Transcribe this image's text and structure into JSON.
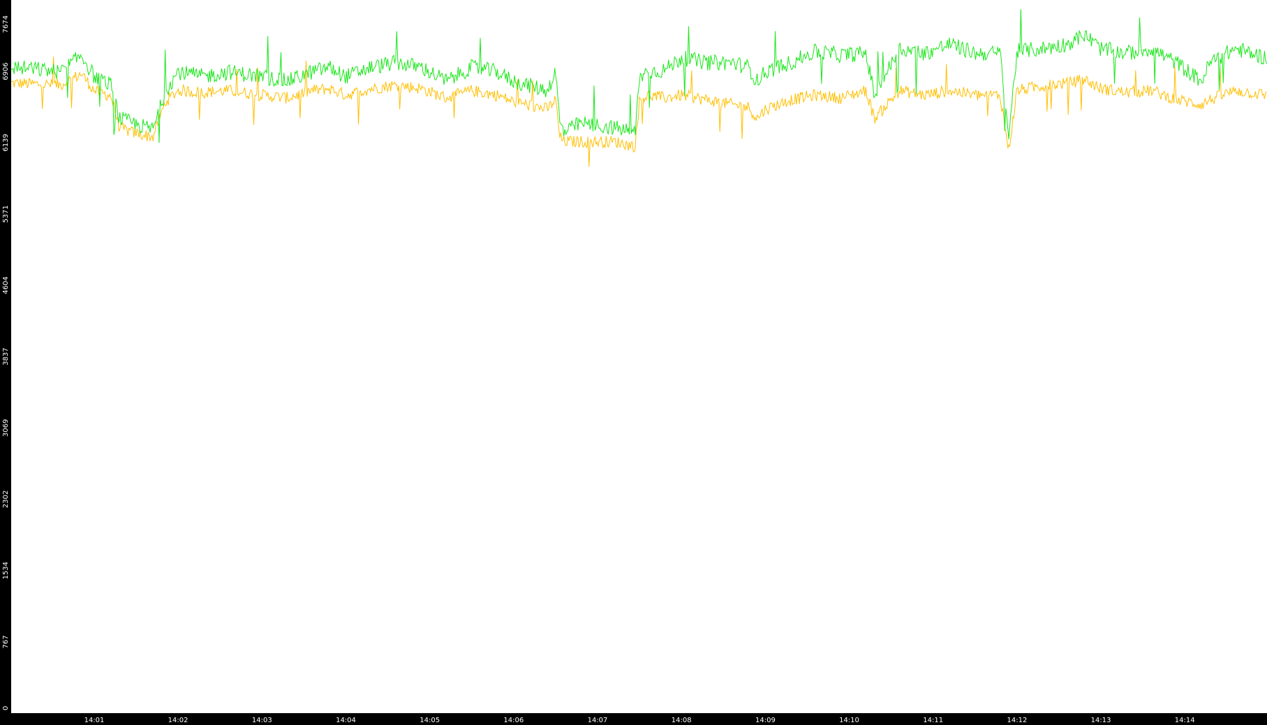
{
  "colors": {
    "background": "#000000",
    "plot": "#ffffff",
    "green": "#19e619",
    "orange": "#ffbf00",
    "text": "#ffffff"
  },
  "chart_data": {
    "type": "line",
    "title": "",
    "xlabel": "",
    "ylabel": "",
    "ylim": [
      0,
      7674
    ],
    "y_ticks": [
      "0",
      "767",
      "1534",
      "2302",
      "3069",
      "3837",
      "4604",
      "5371",
      "6139",
      "6906",
      "7674"
    ],
    "x_ticks": [
      "14:01",
      "14:02",
      "14:03",
      "14:04",
      "14:05",
      "14:06",
      "14:07",
      "14:08",
      "14:09",
      "14:10",
      "14:11",
      "14:12",
      "14:13",
      "14:14"
    ],
    "x_unit": "minute (14:00 = 0)",
    "xlim": [
      0.01,
      14.98
    ],
    "grid": false,
    "series": [
      {
        "color": "#19e619",
        "x": [
          0.01,
          0.3,
          0.6,
          0.85,
          1.0,
          1.2,
          1.3,
          1.45,
          1.7,
          1.85,
          2.0,
          2.3,
          2.6,
          3.0,
          3.3,
          3.6,
          3.8,
          4.0,
          4.3,
          4.6,
          4.9,
          5.2,
          5.5,
          5.8,
          6.0,
          6.2,
          6.4,
          6.5,
          6.55,
          6.6,
          6.8,
          7.0,
          7.2,
          7.45,
          7.5,
          7.6,
          7.8,
          8.0,
          8.3,
          8.6,
          8.8,
          8.9,
          9.0,
          9.3,
          9.6,
          9.9,
          10.2,
          10.3,
          10.6,
          10.9,
          11.2,
          11.5,
          11.8,
          11.9,
          12.0,
          12.3,
          12.6,
          12.8,
          13.0,
          13.3,
          13.6,
          13.9,
          14.2,
          14.3,
          14.6,
          14.98
        ],
        "y": [
          6950,
          6930,
          6900,
          7080,
          6850,
          6760,
          6400,
          6350,
          6280,
          6700,
          6900,
          6850,
          6900,
          6850,
          6800,
          6900,
          6950,
          6850,
          6950,
          7000,
          6950,
          6800,
          6950,
          6900,
          6800,
          6750,
          6700,
          6900,
          6350,
          6250,
          6350,
          6320,
          6300,
          6250,
          6850,
          6900,
          6920,
          7050,
          7000,
          7000,
          6950,
          6800,
          6900,
          7000,
          7120,
          7080,
          7100,
          6650,
          7150,
          7100,
          7200,
          7100,
          7100,
          6200,
          7120,
          7150,
          7200,
          7300,
          7150,
          7100,
          7150,
          7000,
          6800,
          7000,
          7150,
          7050
        ]
      },
      {
        "color": "#ffbf00",
        "x": [
          0.01,
          0.3,
          0.6,
          0.85,
          1.0,
          1.2,
          1.3,
          1.45,
          1.7,
          1.85,
          2.0,
          2.3,
          2.6,
          3.0,
          3.3,
          3.6,
          3.8,
          4.0,
          4.3,
          4.6,
          4.9,
          5.2,
          5.5,
          5.8,
          6.0,
          6.2,
          6.4,
          6.5,
          6.55,
          6.6,
          6.8,
          7.0,
          7.2,
          7.45,
          7.5,
          7.6,
          7.8,
          8.0,
          8.3,
          8.6,
          8.8,
          8.9,
          9.0,
          9.3,
          9.6,
          9.9,
          10.2,
          10.3,
          10.6,
          10.9,
          11.2,
          11.5,
          11.8,
          11.9,
          12.0,
          12.3,
          12.6,
          12.8,
          13.0,
          13.3,
          13.6,
          13.9,
          14.2,
          14.3,
          14.6,
          14.98
        ],
        "y": [
          6780,
          6770,
          6760,
          6880,
          6700,
          6640,
          6300,
          6250,
          6200,
          6580,
          6700,
          6680,
          6700,
          6650,
          6620,
          6700,
          6720,
          6650,
          6720,
          6760,
          6720,
          6620,
          6700,
          6650,
          6580,
          6540,
          6500,
          6600,
          6200,
          6150,
          6150,
          6150,
          6150,
          6100,
          6600,
          6650,
          6620,
          6650,
          6600,
          6550,
          6520,
          6400,
          6500,
          6600,
          6650,
          6620,
          6700,
          6400,
          6700,
          6650,
          6700,
          6650,
          6650,
          6050,
          6700,
          6750,
          6780,
          6820,
          6720,
          6680,
          6700,
          6600,
          6550,
          6600,
          6700,
          6650
        ]
      }
    ]
  }
}
